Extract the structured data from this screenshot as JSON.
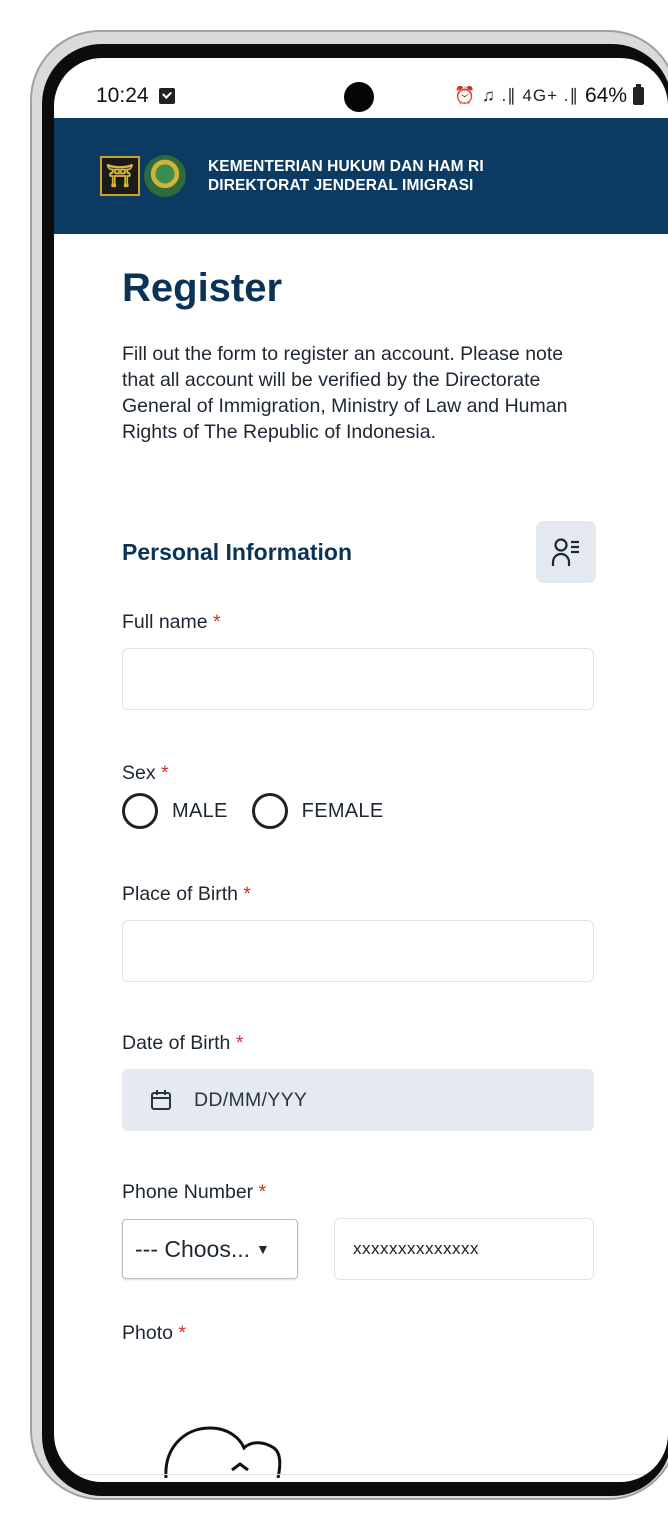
{
  "status_bar": {
    "time": "10:24",
    "right_glyphs": "⏰ ♫ .∥ 4G+ .∥",
    "battery": "64%"
  },
  "header": {
    "line1": "KEMENTERIAN HUKUM DAN HAM RI",
    "line2": "DIREKTORAT JENDERAL IMIGRASI",
    "background_color": "#0b3a63"
  },
  "page": {
    "title": "Register",
    "intro": "Fill out the form to register an account. Please note that all account will be verified by the Directorate General of Immigration, Ministry of Law and Human Rights of The Republic of Indonesia."
  },
  "personal_info": {
    "section_title": "Personal Information",
    "section_icon": "user-list-icon",
    "required_mark": "*",
    "full_name": {
      "label": "Full name",
      "value": ""
    },
    "sex": {
      "label": "Sex",
      "options": [
        "MALE",
        "FEMALE"
      ],
      "selected": ""
    },
    "place_of_birth": {
      "label": "Place of Birth",
      "value": ""
    },
    "date_of_birth": {
      "label": "Date of Birth",
      "placeholder": "DD/MM/YYY"
    },
    "phone_number": {
      "label": "Phone Number",
      "code_selected": "--- Choos...",
      "placeholder": "xxxxxxxxxxxxxx"
    },
    "photo": {
      "label": "Photo",
      "icon": "cloud-upload-icon"
    }
  },
  "colors": {
    "title": "#0b3358",
    "required": "#d0322f",
    "date_field_bg": "#e4eaf0"
  }
}
